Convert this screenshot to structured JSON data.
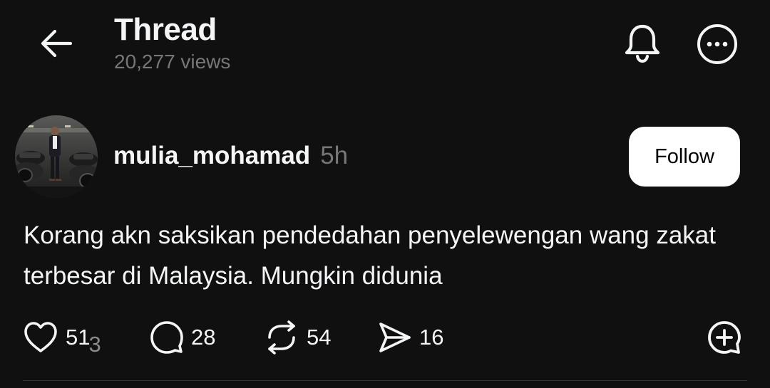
{
  "header": {
    "title": "Thread",
    "views": "20,277 views",
    "icons": {
      "back": "arrow-left-icon",
      "notifications": "bell-icon",
      "more": "more-horizontal-icon"
    }
  },
  "post": {
    "author": {
      "username": "mulia_mohamad",
      "timestamp": "5h",
      "avatar": "avatar-photo"
    },
    "follow_label": "Follow",
    "text": "Korang akn saksikan pendedahan penyelewengan wang zakat terbesar di Malaysia. Mungkin didunia",
    "actions": {
      "likes": "51",
      "likes_sub": "3",
      "comments": "28",
      "reposts": "54",
      "shares": "16"
    }
  },
  "colors": {
    "background": "#101010",
    "text_primary": "#f3f5f7",
    "text_secondary": "#777777",
    "follow_bg": "#ffffff"
  }
}
